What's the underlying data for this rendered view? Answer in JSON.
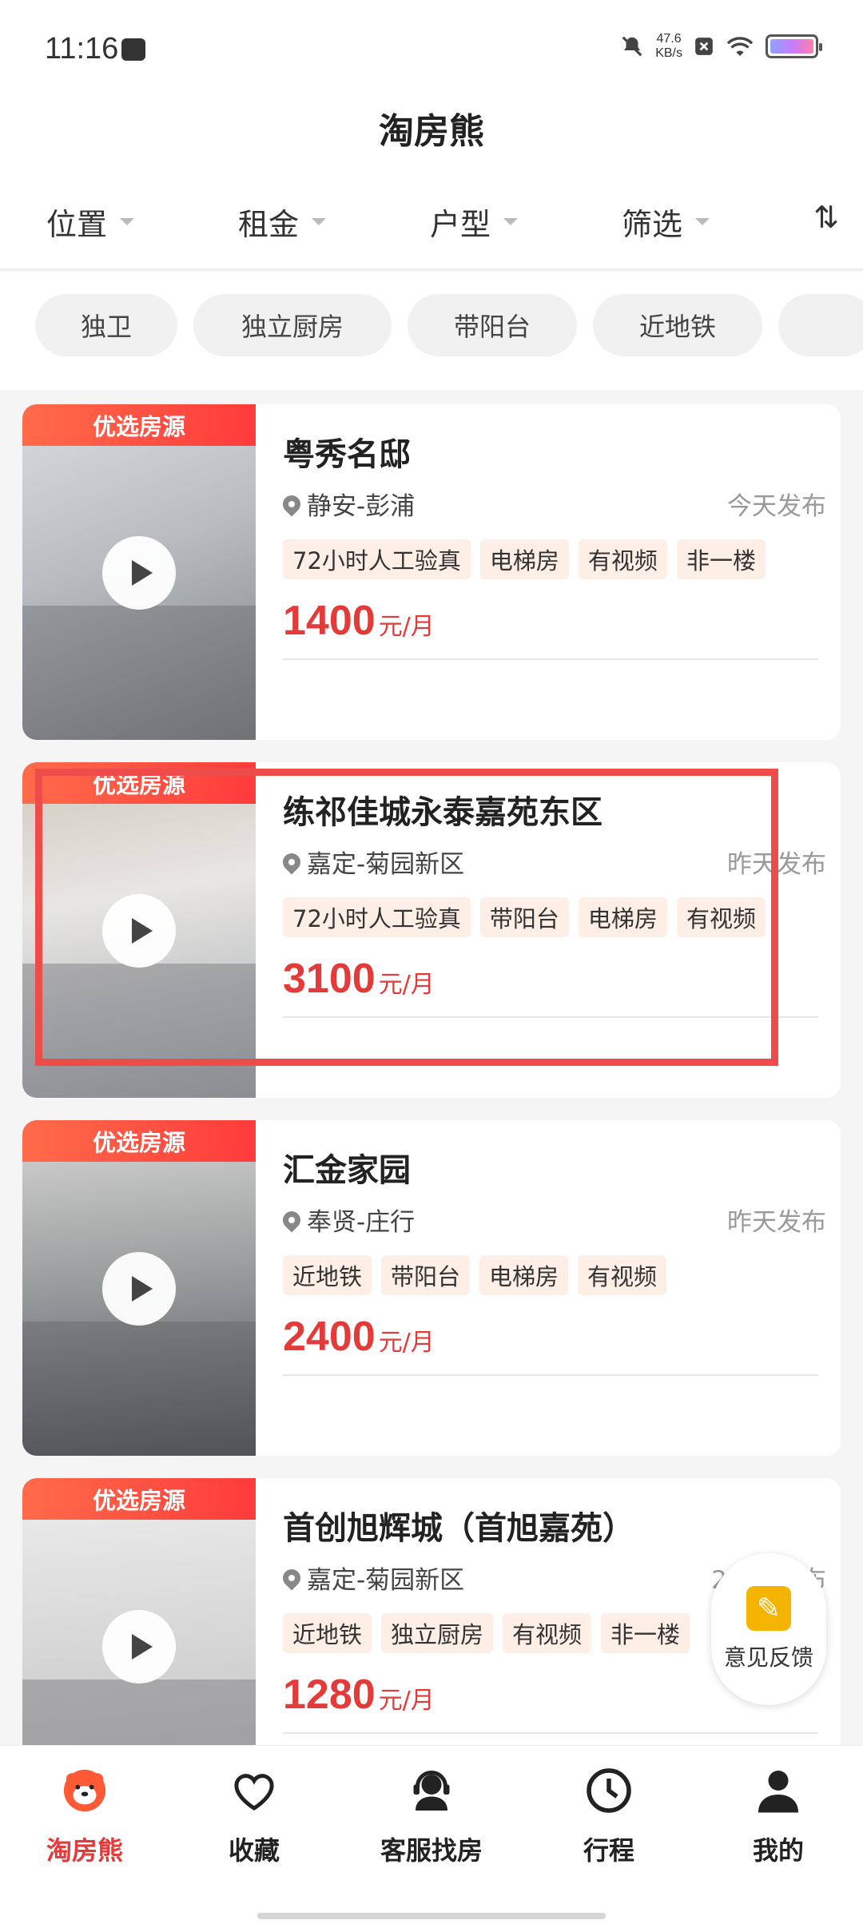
{
  "status": {
    "time": "11:16",
    "speed_top": "47.6",
    "speed_unit": "KB/s"
  },
  "header": {
    "title": "淘房熊"
  },
  "filters": [
    {
      "label": "位置"
    },
    {
      "label": "租金"
    },
    {
      "label": "户型"
    },
    {
      "label": "筛选"
    }
  ],
  "sort_glyph": "⇅",
  "tags": [
    "独卫",
    "独立厨房",
    "带阳台",
    "近地铁"
  ],
  "listings": [
    {
      "badge": "优选房源",
      "title": "粤秀名邸",
      "location": "静安-彭浦",
      "date": "今天发布",
      "chips": [
        "72小时人工验真",
        "电梯房",
        "有视频",
        "非一楼"
      ],
      "price": "1400",
      "unit": "元/月"
    },
    {
      "badge": "优选房源",
      "title": "练祁佳城永泰嘉苑东区",
      "location": "嘉定-菊园新区",
      "date": "昨天发布",
      "chips": [
        "72小时人工验真",
        "带阳台",
        "电梯房",
        "有视频"
      ],
      "price": "3100",
      "unit": "元/月"
    },
    {
      "badge": "优选房源",
      "title": "汇金家园",
      "location": "奉贤-庄行",
      "date": "昨天发布",
      "chips": [
        "近地铁",
        "带阳台",
        "电梯房",
        "有视频"
      ],
      "price": "2400",
      "unit": "元/月"
    },
    {
      "badge": "优选房源",
      "title": "首创旭辉城（首旭嘉苑）",
      "location": "嘉定-菊园新区",
      "date": "2天前发布",
      "chips": [
        "近地铁",
        "独立厨房",
        "有视频",
        "非一楼"
      ],
      "price": "1280",
      "unit": "元/月"
    }
  ],
  "feedback": {
    "label": "意见反馈"
  },
  "tabs": [
    {
      "label": "淘房熊",
      "icon": "bear-logo-icon"
    },
    {
      "label": "收藏",
      "icon": "heart-icon"
    },
    {
      "label": "客服找房",
      "icon": "headset-agent-icon"
    },
    {
      "label": "行程",
      "icon": "clock-icon"
    },
    {
      "label": "我的",
      "icon": "person-icon"
    }
  ],
  "colors": {
    "accent": "#e33a3a",
    "badge": "#ff4b3b",
    "chip_bg": "#fdeee6",
    "highlight": "#ee4b4b"
  }
}
